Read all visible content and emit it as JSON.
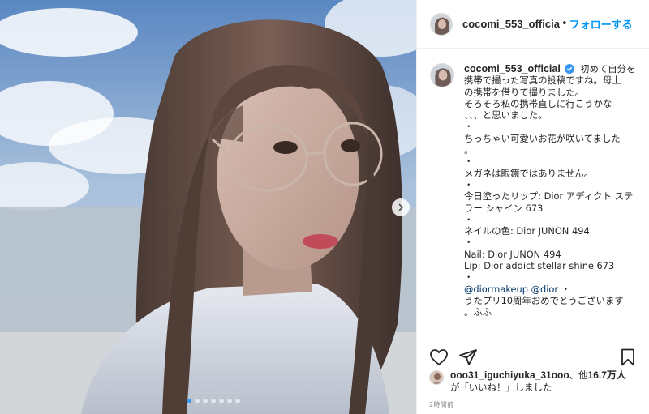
{
  "photo": {
    "alt": "",
    "carousel_count": 7,
    "carousel_active": 0
  },
  "header": {
    "username": "cocomi_553_officia",
    "separator": "•",
    "follow_label": "フォローする"
  },
  "caption": {
    "username": "cocomi_553_official",
    "lines": [
      "初めて自分を",
      "携帯で撮った写真の投稿ですね。母上",
      "の携帯を借りて撮りました。",
      "そろそろ私の携帯直しに行こうかな",
      "、、、と思いました。",
      "・",
      "ちっちゃい可愛いお花が咲いてました",
      "。",
      "・",
      "メガネは眼鏡ではありません。",
      "・",
      "今日塗ったリップ: Dior アディクト ステ",
      "ラー シャイン 673",
      "・",
      "ネイルの色: Dior JUNON 494",
      "・",
      "Nail: Dior JUNON 494",
      "Lip: Dior addict stellar shine 673",
      "・"
    ],
    "mention1": "@diormakeup",
    "mention2": "@dior",
    "mention_suffix": " ・",
    "closing_lines": [
      "うたプリ10周年おめでとうございます",
      "。ふふ"
    ]
  },
  "actions": {
    "like_icon": "heart-icon",
    "share_icon": "share-icon",
    "save_icon": "bookmark-icon"
  },
  "likes": {
    "liker": "ooo31_iguchiyuka_31ooo",
    "middle": "、他",
    "count": "16.7万人",
    "suffix": "が「いいね！」しました"
  },
  "timestamp": "2時間前",
  "colors": {
    "link": "#00376b",
    "follow": "#0095f6",
    "verified": "#3897f0",
    "text": "#262626",
    "muted": "#8e8e8e",
    "border": "#efefef"
  }
}
